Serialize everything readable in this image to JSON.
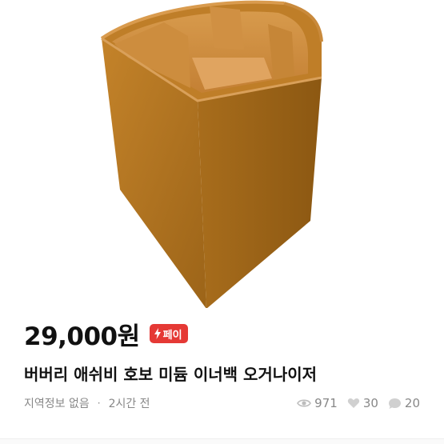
{
  "product": {
    "price": "29,000원",
    "pay_badge": "페이",
    "title": "버버리 애쉬비 호보 미듐 이너백 오거나이저",
    "location": "지역정보 없음",
    "separator": "·",
    "time_ago": "2시간 전",
    "views": "971",
    "likes": "30",
    "chats": "20"
  },
  "colors": {
    "badge": "#e53935",
    "felt": "#b5761f",
    "muted": "#888888"
  },
  "icons": {
    "badge": "bolt-icon",
    "views": "eye-icon",
    "likes": "heart-icon",
    "chats": "chat-bubble-icon"
  }
}
